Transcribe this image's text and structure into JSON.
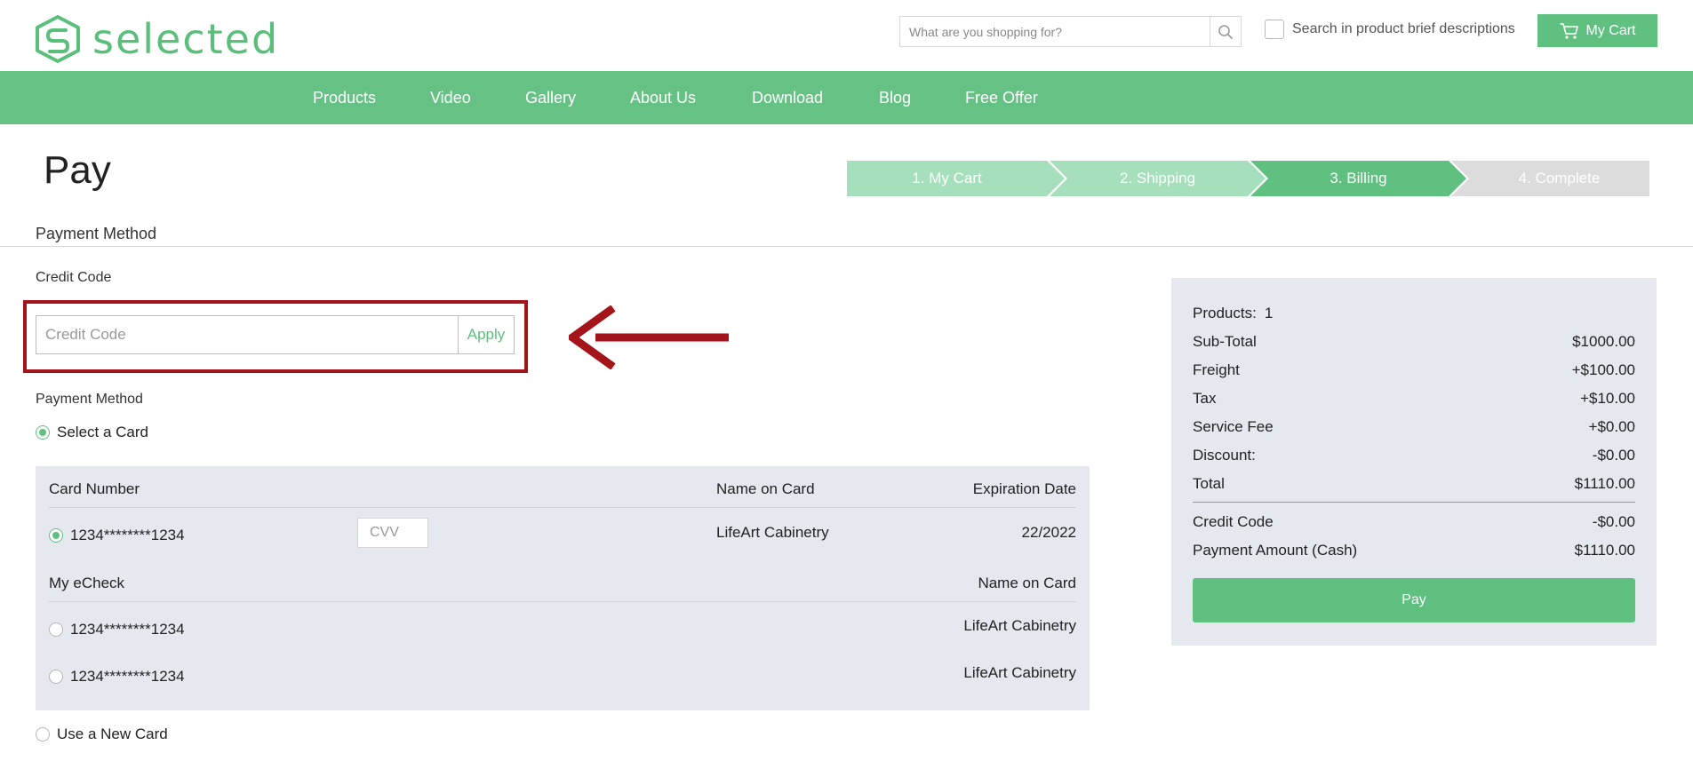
{
  "brand": {
    "name": "selected",
    "color": "#5bbf7c"
  },
  "header": {
    "search_placeholder": "What are you shopping for?",
    "brief_label": "Search in product brief descriptions",
    "cart_label": "My Cart"
  },
  "nav": [
    "Products",
    "Video",
    "Gallery",
    "About Us",
    "Download",
    "Blog",
    "Free Offer"
  ],
  "page": {
    "title": "Pay",
    "section_title": "Payment Method"
  },
  "steps": [
    {
      "label": "1. My Cart",
      "state": "done"
    },
    {
      "label": "2. Shipping",
      "state": "done"
    },
    {
      "label": "3. Billing",
      "state": "active"
    },
    {
      "label": "4. Complete",
      "state": "pending"
    }
  ],
  "credit": {
    "label": "Credit Code",
    "placeholder": "Credit Code",
    "apply": "Apply"
  },
  "payment": {
    "label": "Payment Method",
    "select_card": "Select a Card",
    "new_card": "Use a New Card",
    "card_headers": {
      "number": "Card Number",
      "name": "Name on Card",
      "expiration": "Expiration Date"
    },
    "cards": [
      {
        "number": "1234********1234",
        "cvv_placeholder": "CVV",
        "name": "LifeArt Cabinetry",
        "expiration": "22/2022"
      }
    ],
    "echeck_headers": {
      "title": "My eCheck",
      "name": "Name on Card"
    },
    "echecks": [
      {
        "number": "1234********1234",
        "name": "LifeArt Cabinetry"
      },
      {
        "number": "1234********1234",
        "name": "LifeArt Cabinetry"
      }
    ]
  },
  "summary": {
    "products_label": "Products:",
    "products_count": "1",
    "rows": [
      {
        "label": "Sub-Total",
        "value": "$1000.00"
      },
      {
        "label": "Freight",
        "value": "+$100.00"
      },
      {
        "label": "Tax",
        "value": "+$10.00"
      },
      {
        "label": "Service Fee",
        "value": "+$0.00"
      },
      {
        "label": "Discount:",
        "value": "-$0.00"
      },
      {
        "label": "Total",
        "value": "$1110.00"
      }
    ],
    "credit_code": {
      "label": "Credit Code",
      "value": "-$0.00"
    },
    "payment_amount": {
      "label": "Payment Amount (Cash)",
      "value": "$1110.00"
    },
    "pay_label": "Pay"
  },
  "colors": {
    "green": "#5fc080",
    "nav_green": "#66c184",
    "light_green": "#a6dfbb",
    "grey_step": "#dcdcdc",
    "panel": "#e6e8ef",
    "highlight": "#a3151a"
  }
}
